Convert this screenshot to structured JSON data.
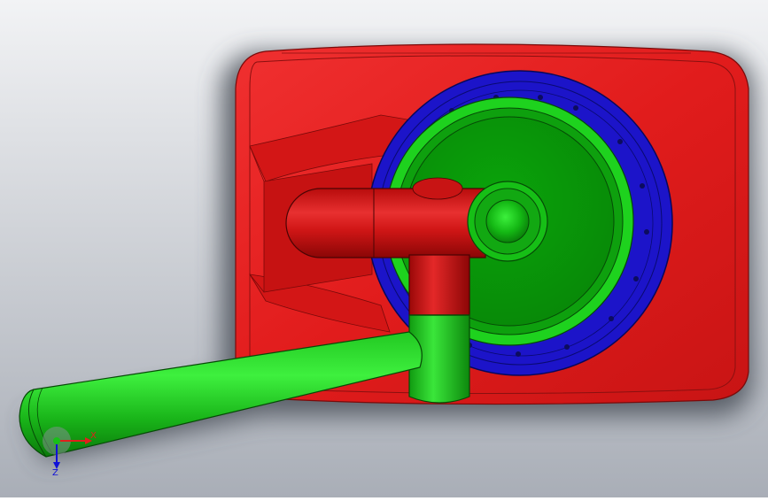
{
  "viewport": {
    "background_top": "#f2f3f5",
    "background_bottom": "#a8adb6"
  },
  "model": {
    "housing_color": "#e11d1d",
    "flange_color": "#1c14c9",
    "rotor_color": "#0a9a0a",
    "handle_color": "#1ed21e"
  },
  "triad": {
    "x_label": "X",
    "z_label": "Z",
    "x_color": "#e0201c",
    "y_color": "#18c018",
    "z_color": "#1010d8"
  }
}
